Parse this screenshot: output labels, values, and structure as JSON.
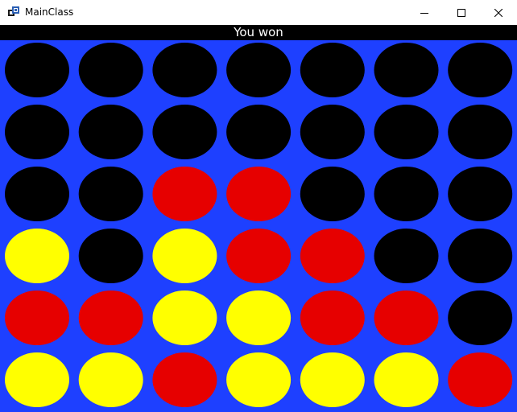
{
  "window": {
    "title": "MainClass",
    "icon": "java-app-icon",
    "controls": [
      "minimize-icon",
      "maximize-icon",
      "close-icon"
    ]
  },
  "status": {
    "message": "You won"
  },
  "colors": {
    "board": "#1e40ff",
    "empty": "#000000",
    "red": "#e60000",
    "yellow": "#ffff00"
  },
  "board": {
    "columns": 7,
    "rows": 6,
    "cells": [
      [
        "empty",
        "empty",
        "empty",
        "empty",
        "empty",
        "empty",
        "empty"
      ],
      [
        "empty",
        "empty",
        "empty",
        "empty",
        "empty",
        "empty",
        "empty"
      ],
      [
        "empty",
        "empty",
        "red",
        "red",
        "empty",
        "empty",
        "empty"
      ],
      [
        "yellow",
        "empty",
        "yellow",
        "red",
        "red",
        "empty",
        "empty"
      ],
      [
        "red",
        "red",
        "yellow",
        "yellow",
        "red",
        "red",
        "empty"
      ],
      [
        "yellow",
        "yellow",
        "red",
        "yellow",
        "yellow",
        "yellow",
        "red"
      ]
    ]
  }
}
